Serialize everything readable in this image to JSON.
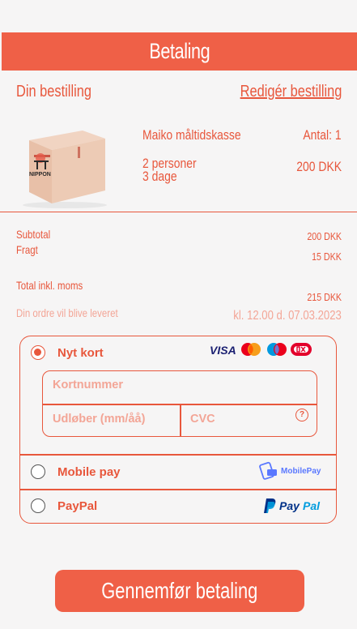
{
  "header": {
    "title": "Betaling"
  },
  "order": {
    "heading": "Din bestilling",
    "edit_link": "Redigér bestilling",
    "product_name": "Maiko måltidskasse",
    "quantity": "Antal: 1",
    "persons": "2 personer",
    "days": "3 dage",
    "price": "200 DKK",
    "box_brand": "NIPPON"
  },
  "summary": {
    "subtotal_label": "Subtotal",
    "subtotal_value": "200 DKK",
    "shipping_label": "Fragt",
    "shipping_value": "15 DKK",
    "total_label": "Total inkl. moms",
    "total_value": "215 DKK",
    "delivery_label": "Din ordre vil blive leveret",
    "delivery_value": "kl. 12.00 d. 07.03.2023"
  },
  "payment": {
    "new_card_label": "Nyt kort",
    "card_number_placeholder": "Kortnummer",
    "expiry_placeholder": "Udløber (mm/åå)",
    "cvc_placeholder": "CVC",
    "cvc_help": "?",
    "mobilepay_label": "Mobile pay",
    "mobilepay_logo": "MobilePay",
    "paypal_label": "PayPal",
    "paypal_logo_pay": "Pay",
    "paypal_logo_pal": "Pal",
    "visa_logo": "VISA"
  },
  "cta": {
    "label": "Gennemfør betaling"
  },
  "colors": {
    "accent": "#ef6047",
    "text_accent": "#e8573c",
    "background": "#f6f5f5"
  }
}
